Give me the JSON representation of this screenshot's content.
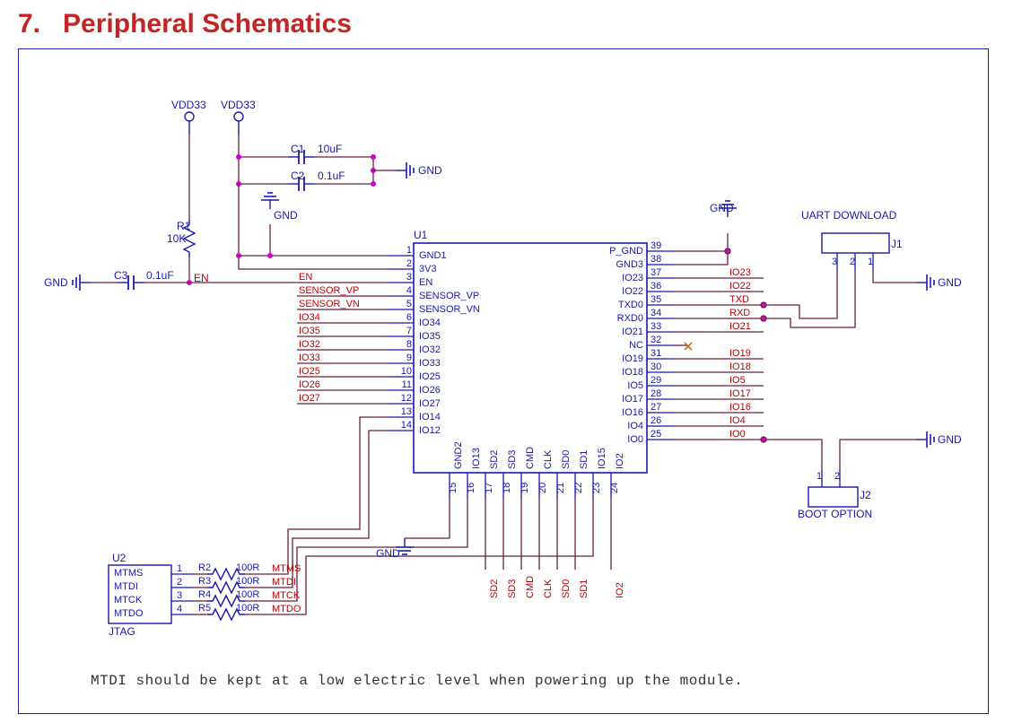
{
  "section_number": "7.",
  "section_title": "Peripheral Schematics",
  "power_rails": {
    "vdd_a": "VDD33",
    "vdd_b": "VDD33"
  },
  "connectors": {
    "uart": {
      "label": "UART DOWNLOAD",
      "ref": "J1",
      "pins": [
        "3",
        "2",
        "1"
      ]
    },
    "boot": {
      "label": "BOOT OPTION",
      "ref": "J2",
      "pins": [
        "1",
        "2"
      ]
    }
  },
  "gnd_labels": [
    "GND",
    "GND",
    "GND",
    "GND",
    "GND",
    "GND",
    "GND"
  ],
  "components": {
    "C1": {
      "ref": "C1",
      "val": "10uF"
    },
    "C2": {
      "ref": "C2",
      "val": "0.1uF"
    },
    "C3": {
      "ref": "C3",
      "val": "0.1uF"
    },
    "R1": {
      "ref": "R1",
      "val": "10K"
    },
    "R2": {
      "ref": "R2",
      "val": "100R"
    },
    "R3": {
      "ref": "R3",
      "val": "100R"
    },
    "R4": {
      "ref": "R4",
      "val": "100R"
    },
    "R5": {
      "ref": "R5",
      "val": "100R"
    }
  },
  "u1": {
    "ref": "U1",
    "left": [
      {
        "n": "1",
        "name": "GND1",
        "net": ""
      },
      {
        "n": "2",
        "name": "3V3",
        "net": ""
      },
      {
        "n": "3",
        "name": "EN",
        "net": "EN"
      },
      {
        "n": "4",
        "name": "SENSOR_VP",
        "net": "SENSOR_VP"
      },
      {
        "n": "5",
        "name": "SENSOR_VN",
        "net": "SENSOR_VN"
      },
      {
        "n": "6",
        "name": "IO34",
        "net": "IO34"
      },
      {
        "n": "7",
        "name": "IO35",
        "net": "IO35"
      },
      {
        "n": "8",
        "name": "IO32",
        "net": "IO32"
      },
      {
        "n": "9",
        "name": "IO33",
        "net": "IO33"
      },
      {
        "n": "10",
        "name": "IO25",
        "net": "IO25"
      },
      {
        "n": "11",
        "name": "IO26",
        "net": "IO26"
      },
      {
        "n": "12",
        "name": "IO27",
        "net": "IO27"
      },
      {
        "n": "13",
        "name": "IO14",
        "net": ""
      },
      {
        "n": "14",
        "name": "IO12",
        "net": ""
      }
    ],
    "right": [
      {
        "n": "39",
        "name": "P_GND",
        "net": ""
      },
      {
        "n": "38",
        "name": "GND3",
        "net": ""
      },
      {
        "n": "37",
        "name": "IO23",
        "net": "IO23"
      },
      {
        "n": "36",
        "name": "IO22",
        "net": "IO22"
      },
      {
        "n": "35",
        "name": "TXD0",
        "net": "TXD"
      },
      {
        "n": "34",
        "name": "RXD0",
        "net": "RXD"
      },
      {
        "n": "33",
        "name": "IO21",
        "net": "IO21"
      },
      {
        "n": "32",
        "name": "NC",
        "net": ""
      },
      {
        "n": "31",
        "name": "IO19",
        "net": "IO19"
      },
      {
        "n": "30",
        "name": "IO18",
        "net": "IO18"
      },
      {
        "n": "29",
        "name": "IO5",
        "net": "IO5"
      },
      {
        "n": "28",
        "name": "IO17",
        "net": "IO17"
      },
      {
        "n": "27",
        "name": "IO16",
        "net": "IO16"
      },
      {
        "n": "26",
        "name": "IO4",
        "net": "IO4"
      },
      {
        "n": "25",
        "name": "IO0",
        "net": "IO0"
      }
    ],
    "bottom": [
      {
        "n": "15",
        "name": "GND2",
        "net": ""
      },
      {
        "n": "16",
        "name": "IO13",
        "net": ""
      },
      {
        "n": "17",
        "name": "SD2",
        "net": "SD2"
      },
      {
        "n": "18",
        "name": "SD3",
        "net": "SD3"
      },
      {
        "n": "19",
        "name": "CMD",
        "net": "CMD"
      },
      {
        "n": "20",
        "name": "CLK",
        "net": "CLK"
      },
      {
        "n": "21",
        "name": "SD0",
        "net": "SD0"
      },
      {
        "n": "22",
        "name": "SD1",
        "net": "SD1"
      },
      {
        "n": "23",
        "name": "IO15",
        "net": ""
      },
      {
        "n": "24",
        "name": "IO2",
        "net": "IO2"
      }
    ]
  },
  "u2": {
    "ref": "U2",
    "label": "JTAG",
    "pins": [
      {
        "n": "1",
        "name": "MTMS",
        "net": "MTMS"
      },
      {
        "n": "2",
        "name": "MTDI",
        "net": "MTDI"
      },
      {
        "n": "3",
        "name": "MTCK",
        "net": "MTCK"
      },
      {
        "n": "4",
        "name": "MTDO",
        "net": "MTDO"
      }
    ]
  },
  "note": "MTDI should be kept at a low electric level when powering up the module."
}
